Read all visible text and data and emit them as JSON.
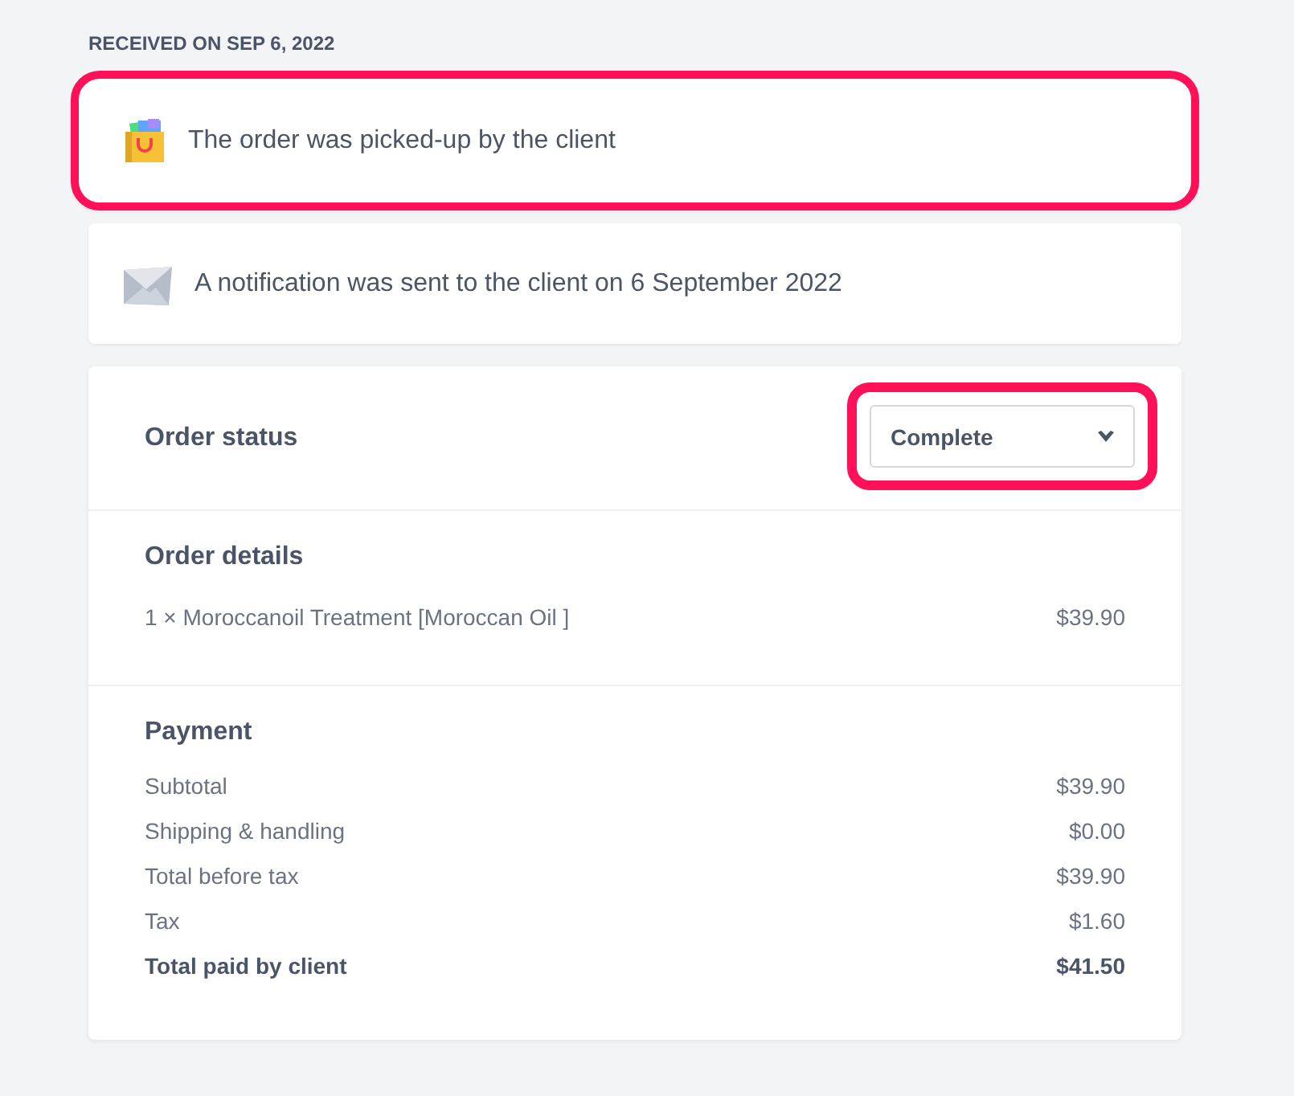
{
  "received_heading": "RECEIVED ON SEP 6, 2022",
  "events": [
    {
      "kind": "pickup",
      "text": "The order was picked-up by the client",
      "highlighted": true
    },
    {
      "kind": "mail",
      "text": "A notification was sent to the client on 6 September 2022",
      "highlighted": false
    }
  ],
  "order_status": {
    "label": "Order status",
    "value": "Complete",
    "highlighted": true
  },
  "order_details": {
    "title": "Order details",
    "items": [
      {
        "text": "1 × Moroccanoil Treatment [Moroccan Oil ]",
        "price": "$39.90"
      }
    ]
  },
  "payment": {
    "title": "Payment",
    "rows": [
      {
        "label": "Subtotal",
        "amount": "$39.90",
        "bold": false
      },
      {
        "label": "Shipping & handling",
        "amount": "$0.00",
        "bold": false
      },
      {
        "label": "Total before tax",
        "amount": "$39.90",
        "bold": false
      },
      {
        "label": "Tax",
        "amount": "$1.60",
        "bold": false
      },
      {
        "label": "Total paid by client",
        "amount": "$41.50",
        "bold": true
      }
    ]
  }
}
